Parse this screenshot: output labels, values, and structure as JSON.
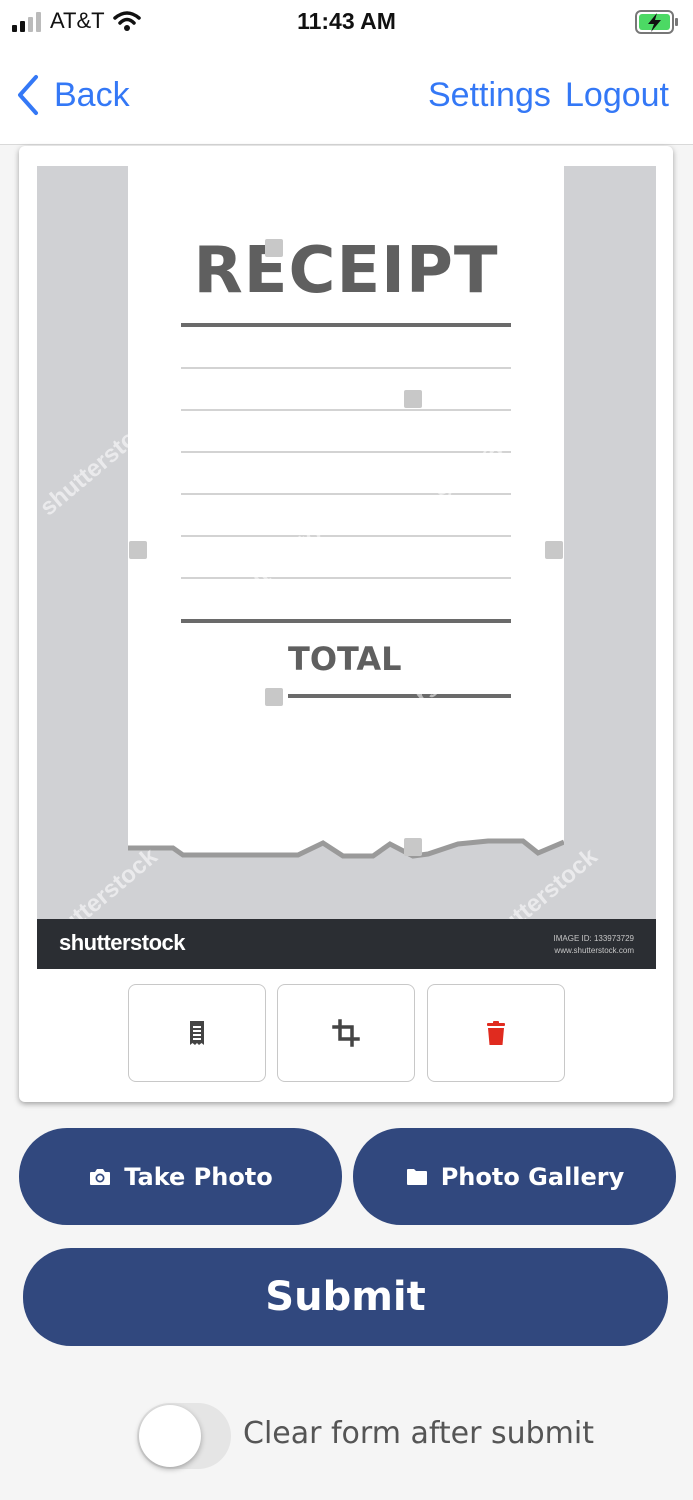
{
  "status_bar": {
    "carrier": "AT&T",
    "time": "11:43 AM",
    "signal_icon": "signal-bars-icon",
    "wifi_icon": "wifi-icon",
    "battery_icon": "battery-charging-icon"
  },
  "nav": {
    "back_label": "Back",
    "settings_label": "Settings",
    "logout_label": "Logout"
  },
  "receipt_preview": {
    "title": "RECEIPT",
    "total_label": "TOTAL",
    "watermark_text": "shutterstock",
    "footer_brand": "shutterstock",
    "footer_image_id": "IMAGE ID: 133973729",
    "footer_url": "www.shutterstock.com"
  },
  "image_tools": [
    {
      "name": "receipt-icon"
    },
    {
      "name": "crop-icon"
    },
    {
      "name": "trash-icon"
    }
  ],
  "actions": {
    "take_photo_label": "Take Photo",
    "photo_gallery_label": "Photo Gallery",
    "submit_label": "Submit"
  },
  "options": {
    "clear_form_label": "Clear form after submit",
    "clear_form_enabled": false
  },
  "colors": {
    "accent": "#3478f6",
    "button": "#31487e",
    "delete": "#e02b1f"
  }
}
